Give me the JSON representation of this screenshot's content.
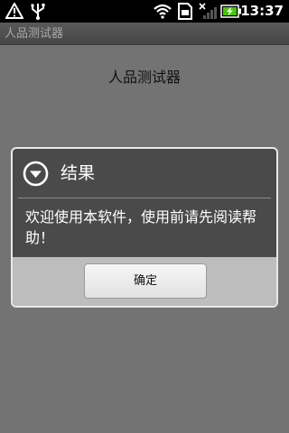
{
  "status_bar": {
    "time": "13:37",
    "icons": [
      "warning-icon",
      "usb-icon",
      "wifi-icon",
      "sim-card-icon",
      "signal-icon",
      "battery-charging-icon"
    ]
  },
  "app": {
    "title": "人品测试器"
  },
  "main": {
    "heading": "人品测试器"
  },
  "dialog": {
    "title": "结果",
    "message": "欢迎使用本软件，使用前请先阅读帮助！",
    "ok_button": "确定"
  },
  "colors": {
    "status_bar": "#000000",
    "background": "#737373",
    "dialog_body": "#4a4a4a",
    "dialog_footer": "#bdbdbd"
  }
}
